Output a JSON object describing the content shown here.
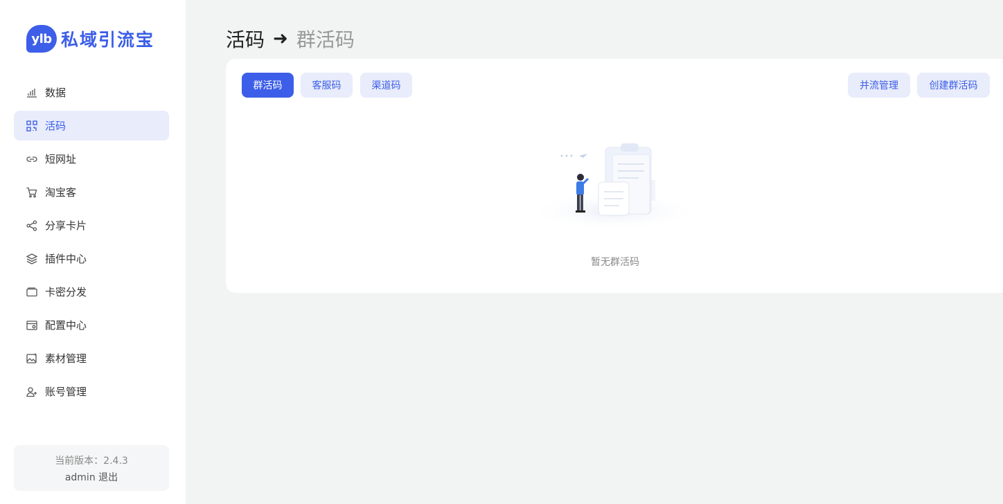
{
  "brand": {
    "badge": "ylb",
    "name": "私域引流宝",
    "accent": "#3c5ee8"
  },
  "sidebar": {
    "items": [
      {
        "label": "数据",
        "icon": "bar-chart-icon"
      },
      {
        "label": "活码",
        "icon": "qrcode-icon",
        "active": true
      },
      {
        "label": "短网址",
        "icon": "link-icon"
      },
      {
        "label": "淘宝客",
        "icon": "shopping-cart-icon"
      },
      {
        "label": "分享卡片",
        "icon": "share-icon"
      },
      {
        "label": "插件中心",
        "icon": "layers-icon"
      },
      {
        "label": "卡密分发",
        "icon": "card-icon"
      },
      {
        "label": "配置中心",
        "icon": "settings-window-icon"
      },
      {
        "label": "素材管理",
        "icon": "image-icon"
      },
      {
        "label": "账号管理",
        "icon": "user-add-icon"
      }
    ],
    "version_text": "当前版本：2.4.3",
    "username": "admin",
    "logout_label": "退出"
  },
  "header": {
    "root": "活码",
    "arrow": "➜",
    "current": "群活码"
  },
  "tabs": [
    {
      "label": "群活码",
      "active": true
    },
    {
      "label": "客服码"
    },
    {
      "label": "渠道码"
    }
  ],
  "actions": {
    "merge_label": "并流管理",
    "create_label": "创建群活码"
  },
  "empty": {
    "text": "暂无群活码"
  }
}
